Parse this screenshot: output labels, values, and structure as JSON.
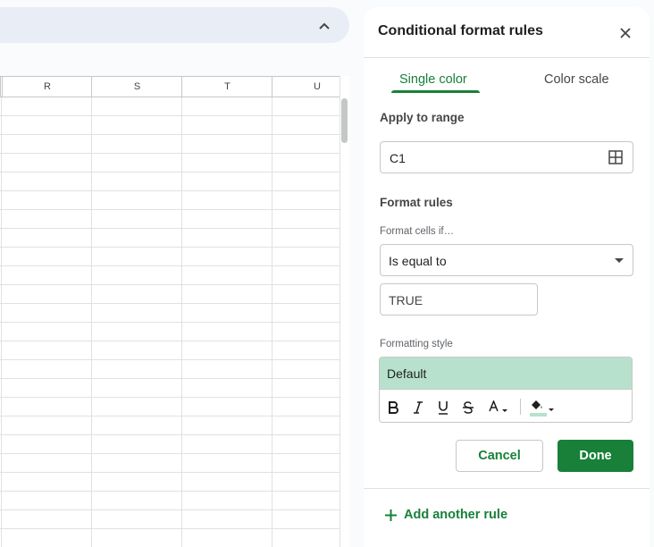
{
  "colors": {
    "accent": "#188038",
    "style_preview_bg": "#b7e1cd",
    "fill_color_bar": "#b7e1cd"
  },
  "toolbar": {
    "collapse_icon": "chevron-up-icon"
  },
  "sheet": {
    "columns": [
      "R",
      "S",
      "T",
      "U"
    ]
  },
  "panel": {
    "title": "Conditional format rules",
    "close_icon": "close-icon",
    "tabs": [
      {
        "label": "Single color",
        "active": true
      },
      {
        "label": "Color scale",
        "active": false
      }
    ],
    "apply_to_range": {
      "label": "Apply to range",
      "value": "C1",
      "icon": "select-range-icon"
    },
    "format_rules": {
      "heading": "Format rules",
      "condition_label": "Format cells if…",
      "condition_value": "Is equal to",
      "dropdown_icon": "dropdown-arrow-icon",
      "value": "TRUE"
    },
    "formatting_style": {
      "label": "Formatting style",
      "preview": "Default",
      "buttons": [
        "bold-icon",
        "italic-icon",
        "underline-icon",
        "strikethrough-icon",
        "text-color-icon",
        "fill-color-icon"
      ]
    },
    "actions": {
      "cancel": "Cancel",
      "done": "Done"
    },
    "add_rule": {
      "icon": "plus-icon",
      "label": "Add another rule"
    }
  }
}
